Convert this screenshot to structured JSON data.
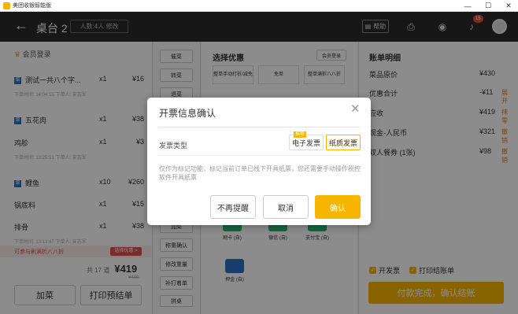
{
  "app": {
    "title": "美团收银智能版"
  },
  "topbar": {
    "back_icon": "arrow-left-icon",
    "table": "桌台 2",
    "people": "人数:4人 修改",
    "help": "帮助",
    "notification_count": "15"
  },
  "left": {
    "member": "会员登录",
    "items": [
      {
        "name": "测试一共八个字...",
        "qty": "x1",
        "price": "¥16",
        "meta": "下单时间:  14:04:15  下单人:  安志军"
      },
      {
        "name": "五花肉",
        "qty": "x1",
        "price": "¥38",
        "meta": ""
      },
      {
        "name": "鸡胗",
        "qty": "x1",
        "price": "¥3",
        "meta": "下单时间:  13:25:51  下单人:  安志军"
      },
      {
        "name": "鲤鱼",
        "qty": "x10",
        "price": "¥260",
        "meta": ""
      },
      {
        "name": "锅底料",
        "qty": "x1",
        "price": "¥15",
        "meta": ""
      },
      {
        "name": "排骨",
        "qty": "x1",
        "price": "¥38",
        "meta": "下单时间:  13:13:47  下单人:  安志军"
      }
    ],
    "promo": "可参与刷满折八八折",
    "promo_button": "选择优惠 >",
    "total_count": "共 17 道",
    "total_amount": "¥419",
    "original_amount": "¥430",
    "add_dish": "加菜",
    "print_bill": "打印预结单"
  },
  "ops": {
    "buttons": [
      "催菜",
      "转菜",
      "退菜",
      "赠菜",
      "改单",
      "拆单",
      "合单",
      "并台",
      "换台",
      "加菜",
      "称重确认",
      "修改重量",
      "补打着单",
      "拼桌",
      "转台"
    ]
  },
  "middle": {
    "title": "选择优惠",
    "member_login": "会员登录",
    "discounts": [
      "整单手动打折/减免",
      "免单",
      "整单满折八八折"
    ],
    "payments": [
      "刷卡 (自)",
      "微信 (自)",
      "支付宝 (自)",
      "押金 (自)"
    ]
  },
  "right": {
    "title": "账单明细",
    "rows": [
      {
        "label": "菜品原价",
        "value": "¥430",
        "action": ""
      },
      {
        "label": "优惠合计",
        "value": "-¥11",
        "action": "展开"
      },
      {
        "label": "应收",
        "value": "¥419",
        "action": "抹零"
      },
      {
        "label": "现金-人民币",
        "value": "¥321",
        "action": "撤销"
      },
      {
        "label": "双人餐券 (1张)",
        "value": "¥98",
        "action": "撤销"
      }
    ],
    "invoice": "开发票",
    "print_receipt": "打印结账单",
    "finish": "付款完成，确认结账"
  },
  "dialog": {
    "title": "开票信息确认",
    "type_label": "发票类型",
    "tag": "推荐",
    "option_electronic": "电子发票",
    "option_paper": "纸质发票",
    "notice": "仅作为标记功能，标记当前订单已线下开具纸票，您还需要手动操作税控软件开具纸票",
    "no_remind": "不再提醒",
    "cancel": "取消",
    "confirm": "确认"
  },
  "colors": {
    "accent": "#f7b500",
    "topbar": "#2a2a2a",
    "danger": "#d9534f"
  }
}
